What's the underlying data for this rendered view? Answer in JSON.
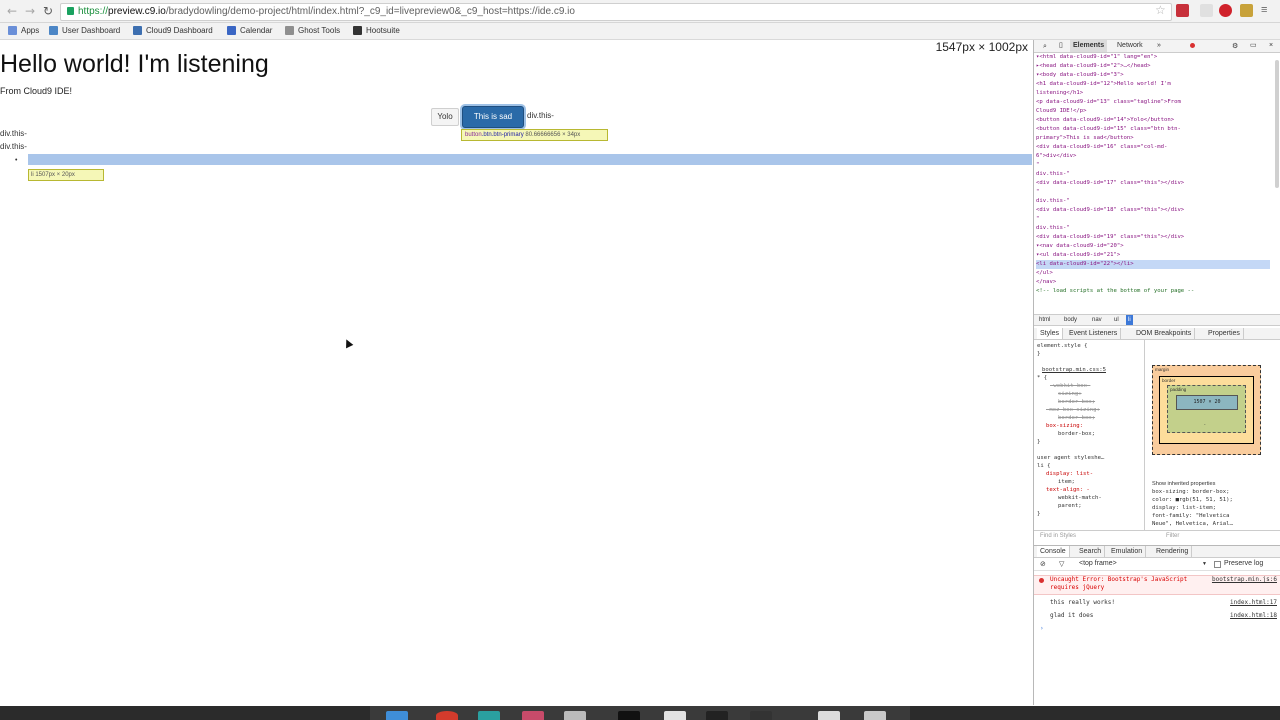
{
  "browser": {
    "url_scheme": "https://",
    "url_host": "preview.c9.io",
    "url_rest": "/bradydowling/demo-project/html/index.html?_c9_id=livepreview0&_c9_host=https://ide.c9.io",
    "bookmarks": [
      {
        "label": "Apps",
        "color": "#6a8fd8"
      },
      {
        "label": "User Dashboard",
        "color": "#4c86c6"
      },
      {
        "label": "Cloud9 Dashboard",
        "color": "#3d6fb0"
      },
      {
        "label": "Calendar",
        "color": "#3a66c4"
      },
      {
        "label": "Ghost Tools",
        "color": "#8f8f8f"
      },
      {
        "label": "Hootsuite",
        "color": "#333333"
      }
    ]
  },
  "page": {
    "dimensions": "1547px × 1002px",
    "heading": "Hello world! I'm listening",
    "tagline": "From Cloud9 IDE!",
    "btn_yolo": "Yolo",
    "btn_sad": "This is sad",
    "after_btn": "div.this-",
    "divthis_1": "div.this-",
    "divthis_2": "div.this-",
    "tooltip_tag": "button",
    "tooltip_cls": ".btn.btn-primary",
    "tooltip_size": "80.66666656 × 34px",
    "li_tooltip": "li 1507px × 20px",
    "bullet": "•"
  },
  "devtools": {
    "tabs": {
      "elements": "Elements",
      "network": "Network",
      "more": "»"
    },
    "dom_lines": [
      "▾<html data-cloud9-id=\"1\" lang=\"en\">",
      "  ▸<head data-cloud9-id=\"2\">…</head>",
      "  ▾<body data-cloud9-id=\"3\">",
      "      <h1 data-cloud9-id=\"12\">Hello world! I'm",
      "      listening</h1>",
      "      <p data-cloud9-id=\"13\" class=\"tagline\">From",
      "      Cloud9 IDE!</p>",
      "      <button data-cloud9-id=\"14\">Yolo</button>",
      "      <button data-cloud9-id=\"15\" class=\"btn btn-",
      "      primary\">This is sad</button>",
      "      <div data-cloud9-id=\"16\" class=\"col-md-",
      "      6\">div</div>",
      "      \"",
      "              div.this-\"",
      "      <div data-cloud9-id=\"17\" class=\"this\"></div>",
      "      \"",
      "              div.this-\"",
      "      <div data-cloud9-id=\"18\" class=\"this\"></div>",
      "      \"",
      "              div.this-\"",
      "      <div data-cloud9-id=\"19\" class=\"this\"></div>",
      "    ▾<nav data-cloud9-id=\"20\">",
      "      ▾<ul data-cloud9-id=\"21\">",
      "          <li data-cloud9-id=\"22\"></li>",
      "        </ul>",
      "      </nav>",
      "      <!-- load scripts at the bottom of your page --"
    ],
    "breadcrumbs": [
      "html",
      "body",
      "nav",
      "ul",
      "li"
    ],
    "side_tabs": [
      "Styles",
      "Event Listeners",
      "DOM Breakpoints",
      "Properties"
    ],
    "styles": {
      "element_style": "element.style {",
      "close": "}",
      "bootstrap_src": "bootstrap.min.css:5",
      "selector": "* {",
      "webkit_box_sizing_1": "-webkit-box-",
      "webkit_box_sizing_2": "sizing:",
      "webkit_box_sizing_3": "border-box;",
      "moz_box_sizing_1": "-moz-box-sizing:",
      "moz_box_sizing_2": "border-box;",
      "box_sizing_1": "box-sizing:",
      "box_sizing_2": "border-box;",
      "ua_label": "user agent styleshe…",
      "li_selector": "li {",
      "display_1": "display: list-",
      "display_2": "item;",
      "text_align_1": "text-align: -",
      "text_align_2": "webkit-match-",
      "text_align_3": "parent;",
      "filter_placeholder": "Find in Styles"
    },
    "box_model": {
      "margin": "margin",
      "border": "border",
      "padding": "padding",
      "content": "1507 × 20",
      "dash": "-"
    },
    "inherited": {
      "toggle": "Show inherited properties",
      "box_sizing": "box-sizing: border-box;",
      "color": "color: ■rgb(51, 51, 51);",
      "display": "display: list-item;",
      "font_family": "font-family: \"Helvetica",
      "font_family_2": "Neue\", Helvetica, Arial…"
    },
    "filter": "Filter",
    "drawer_tabs": [
      "Console",
      "Search",
      "Emulation",
      "Rendering"
    ],
    "console": {
      "frame": "<top frame>",
      "preserve": "Preserve log",
      "lines": [
        {
          "type": "error",
          "msg": "Uncaught Error: Bootstrap's JavaScript requires jQuery",
          "src": "bootstrap.min.js:6"
        },
        {
          "type": "log",
          "msg": "this really works!",
          "src": "index.html:17"
        },
        {
          "type": "log",
          "msg": "glad it does",
          "src": "index.html:18"
        }
      ],
      "prompt": "›"
    }
  },
  "colors": {
    "primary_button": "#2a6aa8",
    "highlight": "#a9c5ea",
    "error": "#d93030"
  }
}
